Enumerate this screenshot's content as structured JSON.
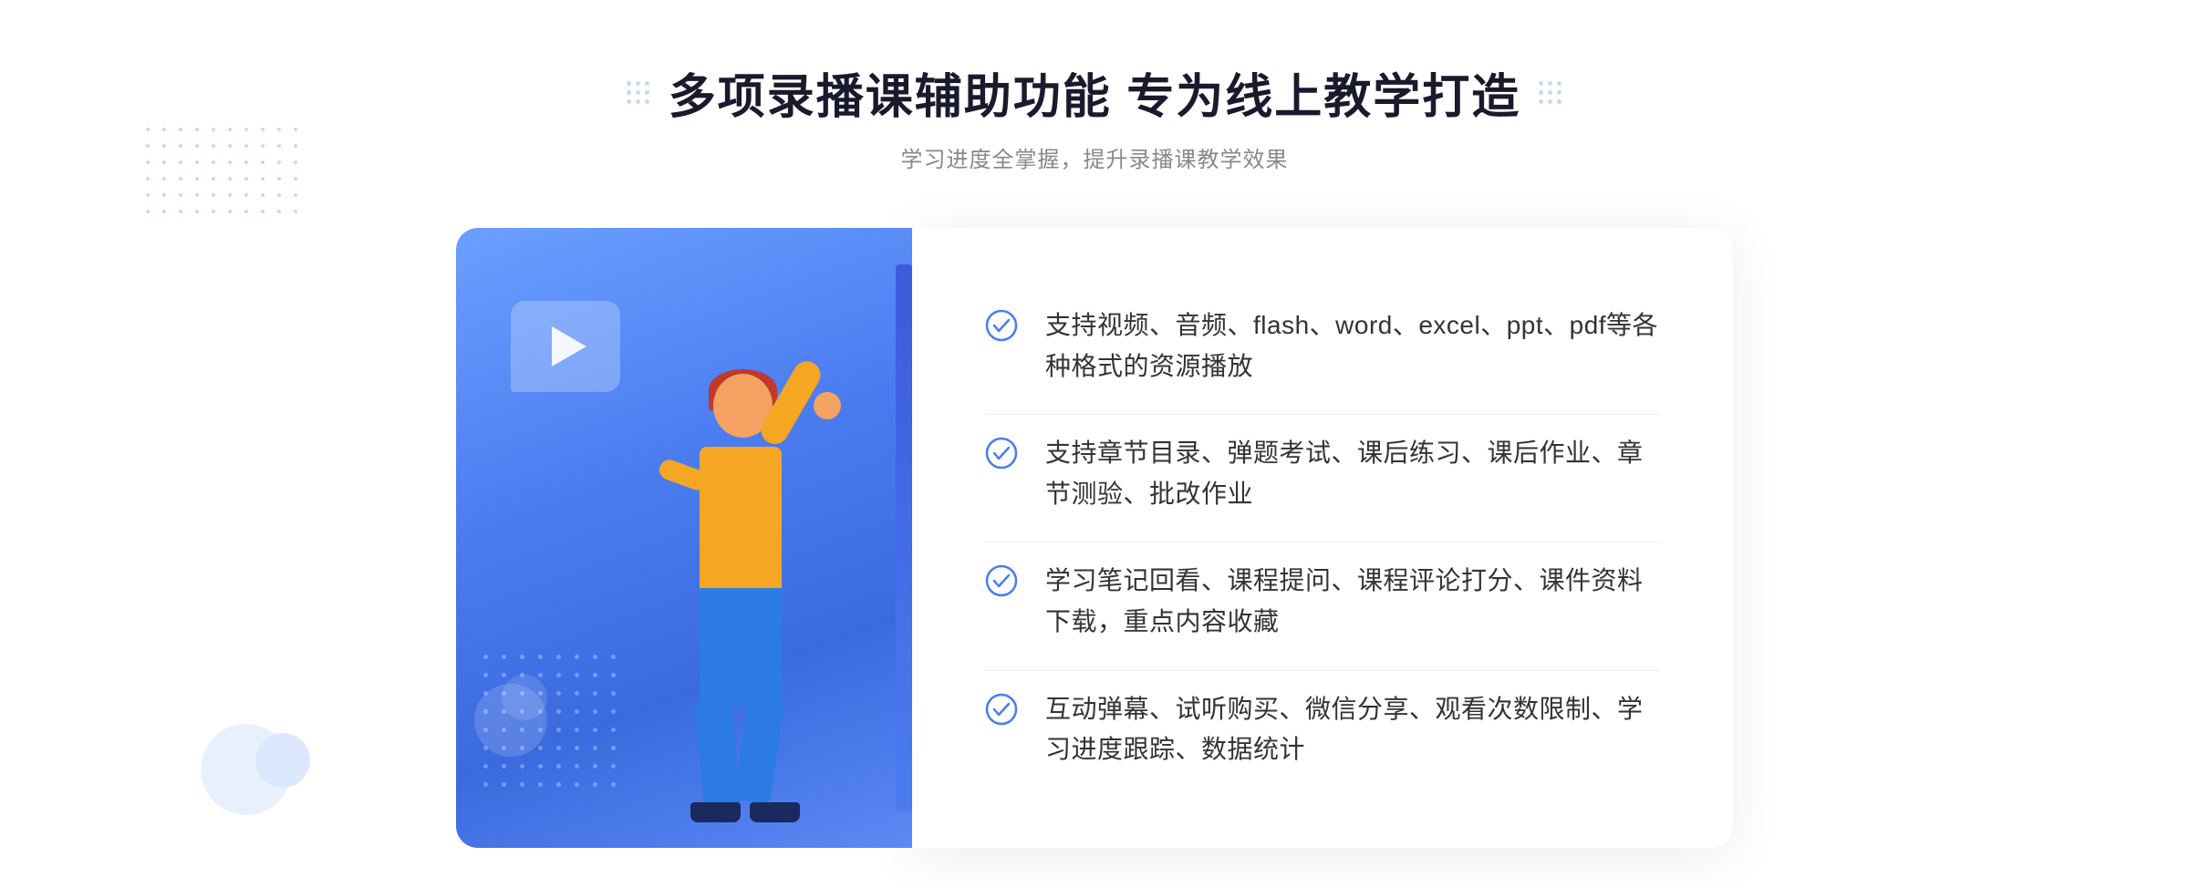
{
  "header": {
    "title": "多项录播课辅助功能 专为线上教学打造",
    "subtitle": "学习进度全掌握，提升录播课教学效果"
  },
  "features": [
    {
      "id": "feature-1",
      "text": "支持视频、音频、flash、word、excel、ppt、pdf等各种格式的资源播放"
    },
    {
      "id": "feature-2",
      "text": "支持章节目录、弹题考试、课后练习、课后作业、章节测验、批改作业"
    },
    {
      "id": "feature-3",
      "text": "学习笔记回看、课程提问、课程评论打分、课件资料下载，重点内容收藏"
    },
    {
      "id": "feature-4",
      "text": "互动弹幕、试听购买、微信分享、观看次数限制、学习进度跟踪、数据统计"
    }
  ],
  "decorators": {
    "left_arrow": "»",
    "right_dots_label": "::"
  }
}
